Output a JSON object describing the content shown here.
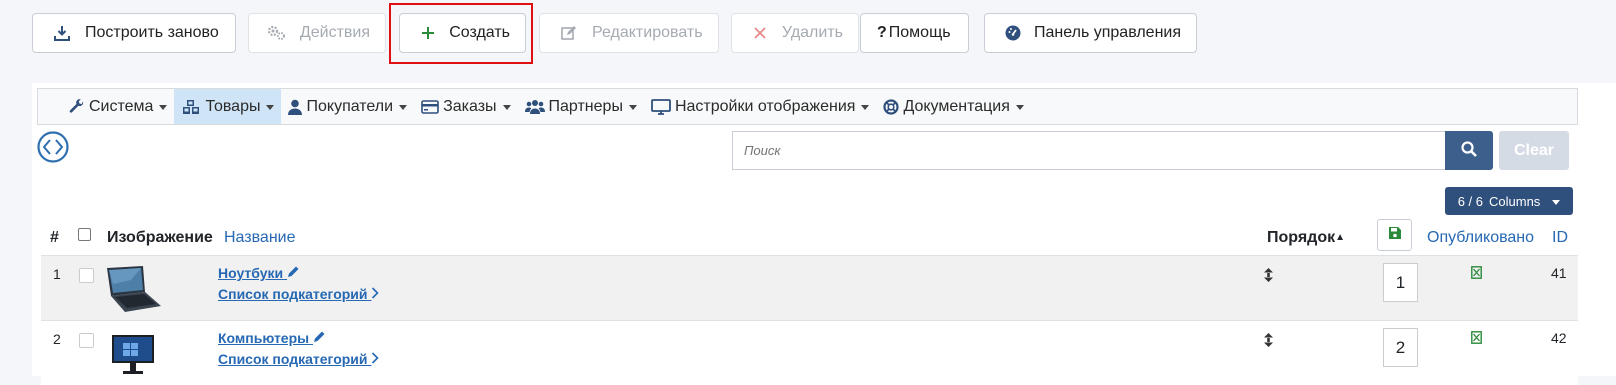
{
  "toolbar": {
    "rebuild_label": "Построить заново",
    "actions_label": "Действия",
    "create_label": "Создать",
    "edit_label": "Редактировать",
    "delete_label": "Удалить",
    "help_label": "Помощь",
    "control_panel_label": "Панель управления"
  },
  "nav": {
    "items": [
      {
        "label": "Система",
        "icon": "wrench-icon"
      },
      {
        "label": "Товары",
        "icon": "cubes-icon",
        "active": true
      },
      {
        "label": "Покупатели",
        "icon": "user-icon"
      },
      {
        "label": "Заказы",
        "icon": "credit-card-icon"
      },
      {
        "label": "Партнеры",
        "icon": "users-icon"
      },
      {
        "label": "Настройки отображения",
        "icon": "desktop-icon"
      },
      {
        "label": "Документация",
        "icon": "lifebuoy-icon"
      }
    ]
  },
  "search": {
    "placeholder": "Поиск",
    "clear_label": "Clear",
    "columns_count": "6 / 6",
    "columns_label": "Columns"
  },
  "table": {
    "headers": {
      "num": "#",
      "image": "Изображение",
      "name": "Название",
      "order": "Порядок",
      "published": "Опубликовано",
      "id": "ID"
    },
    "rows": [
      {
        "num": "1",
        "title": "Ноутбуки",
        "subcats": "Список подкатегорий",
        "order": "1",
        "id": "41"
      },
      {
        "num": "2",
        "title": "Компьютеры",
        "subcats": "Список подкатегорий",
        "order": "2",
        "id": "42"
      }
    ]
  },
  "colors": {
    "accent": "#2f4f7c",
    "link": "#2668b3",
    "highlight": "#e01010",
    "published": "#2a8a3a"
  }
}
